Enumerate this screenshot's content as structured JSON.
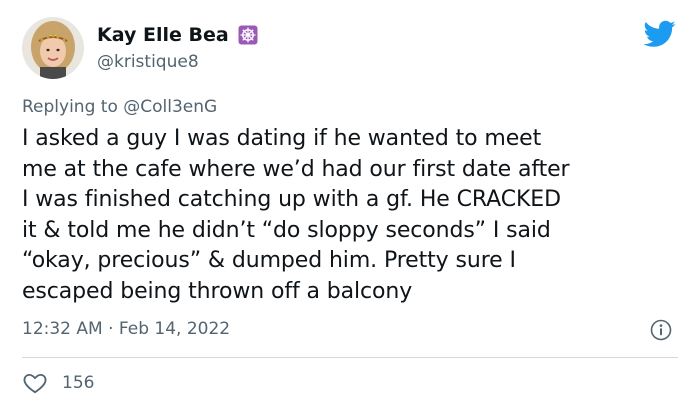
{
  "author": {
    "display_name": "Kay Elle Bea",
    "handle": "@kristique8",
    "name_emoji": "dharma-wheel-icon"
  },
  "reply": {
    "prefix": "Replying to ",
    "mention": "@Coll3enG"
  },
  "tweet": {
    "text": "I asked a guy I was dating if he wanted to meet\nme at the cafe where we’d had our first date after\nI was finished catching up with a gf. He CRACKED\nit & told me he didn’t “do sloppy seconds” I said\n“okay, precious” & dumped him. Pretty sure I\nescaped being thrown off a balcony"
  },
  "meta": {
    "time": "12:32 AM",
    "separator": " · ",
    "date": "Feb 14, 2022"
  },
  "engagement": {
    "likes": "156"
  },
  "icons": {
    "platform": "twitter-bird-icon",
    "info": "info-icon",
    "like": "heart-icon"
  },
  "colors": {
    "brand": "#1d9bf0",
    "text_primary": "#0f1419",
    "text_secondary": "#536471",
    "divider": "#cfd9de",
    "emoji_purple": "#9b59b6"
  }
}
